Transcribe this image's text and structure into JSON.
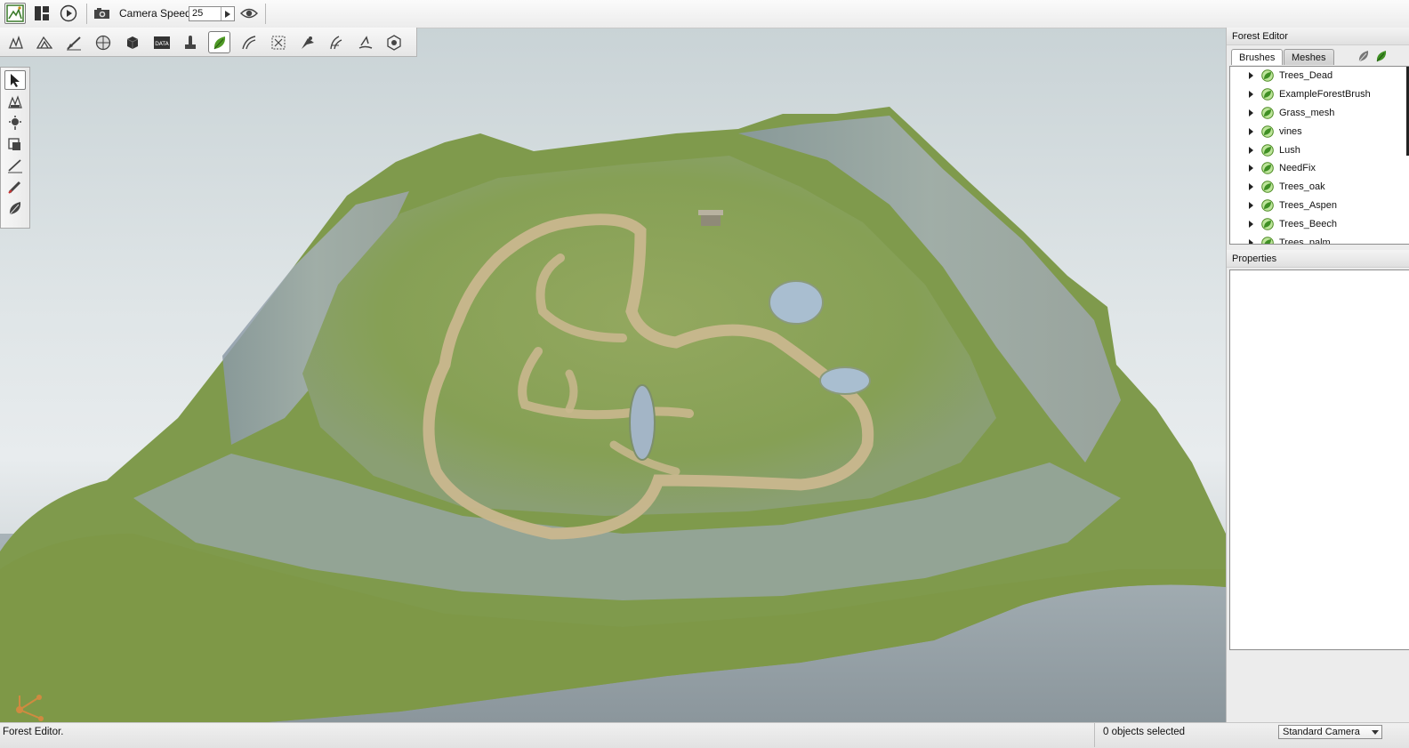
{
  "top_toolbar": {
    "camera_speed_label": "Camera Speed",
    "camera_speed_value": "25",
    "icons": [
      "world-editor-icon",
      "gui-editor-icon",
      "play-icon",
      "camera-icon",
      "visibility-eye-icon"
    ]
  },
  "tool_toolbar": {
    "icons": [
      "object-editor-icon",
      "terrain-editor-icon",
      "terrain-painter-icon",
      "material-editor-icon",
      "sketch-tool-icon",
      "datablock-editor-icon",
      "particle-editor-icon",
      "forest-editor-icon",
      "road-editor-icon",
      "mesh-road-editor-icon",
      "decal-editor-icon",
      "river-editor-icon",
      "shape-editor-icon",
      "convex-editor-icon"
    ],
    "active": "forest-editor-icon"
  },
  "left_palette": {
    "tools": [
      "select-arrow-icon",
      "move-tool-icon",
      "rotate-tool-icon",
      "scale-tool-icon",
      "paint-brush-icon",
      "erase-brush-icon",
      "erase-selected-icon"
    ]
  },
  "sidebar": {
    "forest_editor_title": "Forest Editor",
    "tabs": [
      "Brushes",
      "Meshes"
    ],
    "brushes": [
      "Trees_Dead",
      "ExampleForestBrush",
      "Grass_mesh",
      "vines",
      "Lush",
      "NeedFix",
      "Trees_oak",
      "Trees_Aspen",
      "Trees_Beech",
      "Trees_palm"
    ],
    "properties_title": "Properties"
  },
  "status_bar": {
    "left_text": "Forest Editor.",
    "selection_text": "0 objects selected",
    "camera_mode": "Standard Camera"
  },
  "colors": {
    "terrain_green": "#7d9848",
    "path_tan": "#c9b78e",
    "water_blue": "#a9bed0",
    "sky_top": "#c9d3d6"
  }
}
